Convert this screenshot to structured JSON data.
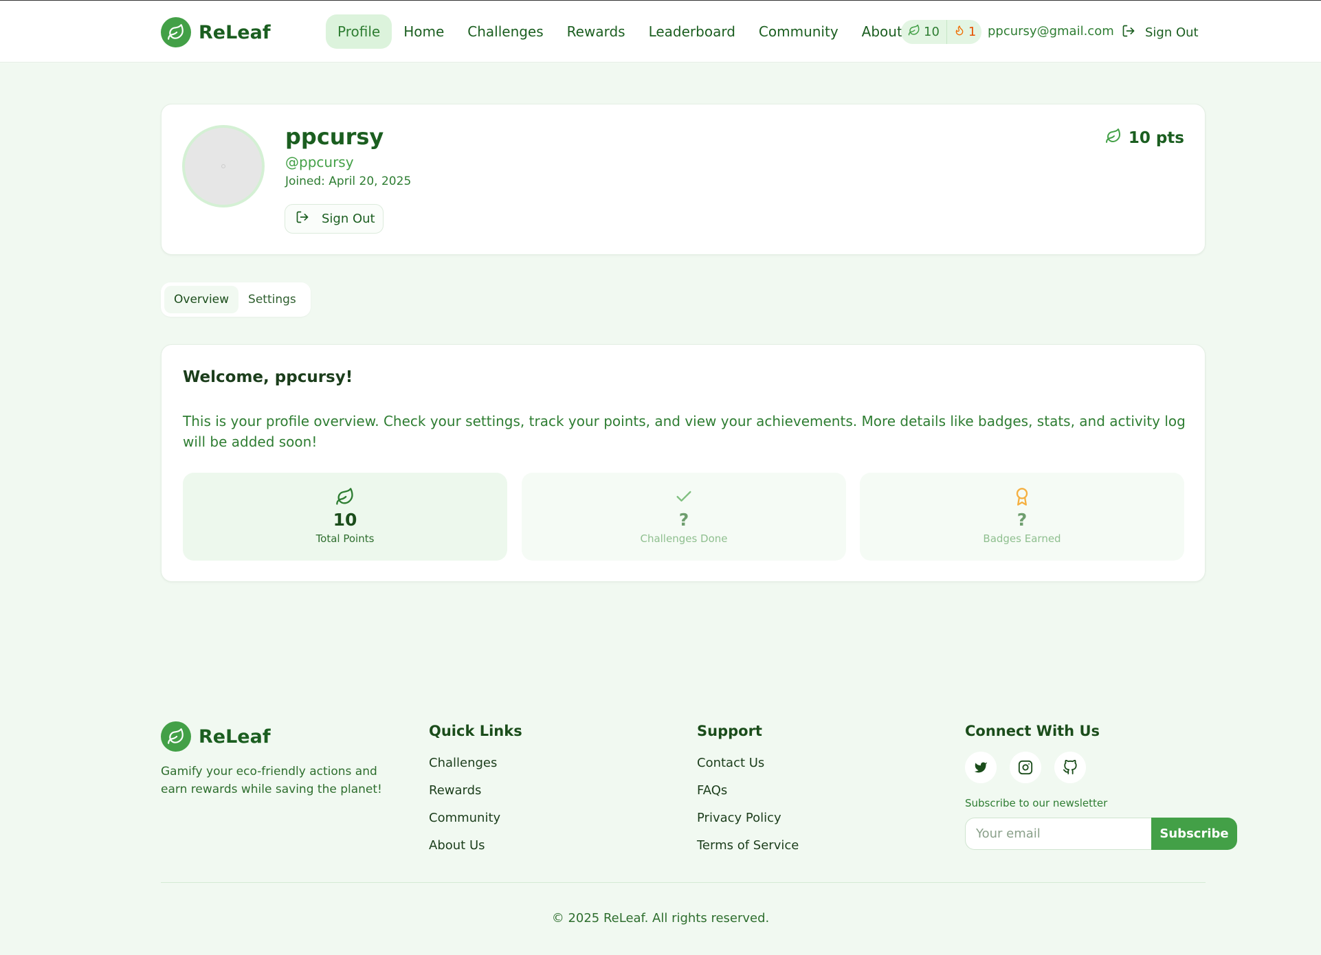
{
  "brand": {
    "name": "ReLeaf"
  },
  "nav": {
    "items": [
      {
        "label": "Profile",
        "active": true
      },
      {
        "label": "Home"
      },
      {
        "label": "Challenges"
      },
      {
        "label": "Rewards"
      },
      {
        "label": "Leaderboard"
      },
      {
        "label": "Community"
      },
      {
        "label": "About"
      }
    ],
    "points": "10",
    "streak": "1",
    "email": "ppcursy@gmail.com",
    "sign_out": "Sign Out"
  },
  "profile": {
    "username": "ppcursy",
    "handle": "@ppcursy",
    "joined": "Joined: April 20, 2025",
    "sign_out": "Sign Out",
    "points_label": "10 pts"
  },
  "tabs": [
    {
      "label": "Overview",
      "active": true
    },
    {
      "label": "Settings"
    }
  ],
  "overview": {
    "welcome": "Welcome, ppcursy!",
    "description": "This is your profile overview. Check your settings, track your points, and view your achievements. More details like badges, stats, and activity log will be added soon!",
    "stats": [
      {
        "value": "10",
        "caption": "Total Points",
        "icon": "leaf-icon"
      },
      {
        "value": "?",
        "caption": "Challenges Done",
        "icon": "check-icon"
      },
      {
        "value": "?",
        "caption": "Badges Earned",
        "icon": "award-icon"
      }
    ]
  },
  "footer": {
    "brand": "ReLeaf",
    "tagline": "Gamify your eco-friendly actions and earn rewards while saving the planet!",
    "quick_links": {
      "title": "Quick Links",
      "links": [
        "Challenges",
        "Rewards",
        "Community",
        "About Us"
      ]
    },
    "support": {
      "title": "Support",
      "links": [
        "Contact Us",
        "FAQs",
        "Privacy Policy",
        "Terms of Service"
      ]
    },
    "connect": {
      "title": "Connect With Us",
      "socials": [
        "twitter-icon",
        "instagram-icon",
        "github-icon"
      ],
      "newsletter_label": "Subscribe to our newsletter",
      "email_placeholder": "Your email",
      "subscribe": "Subscribe"
    },
    "copyright": "© 2025 ReLeaf. All rights reserved."
  },
  "colors": {
    "accent": "#43a047",
    "text_dark": "#1b5e20",
    "page_bg": "#f1f9f1",
    "streak": "#e65100"
  }
}
